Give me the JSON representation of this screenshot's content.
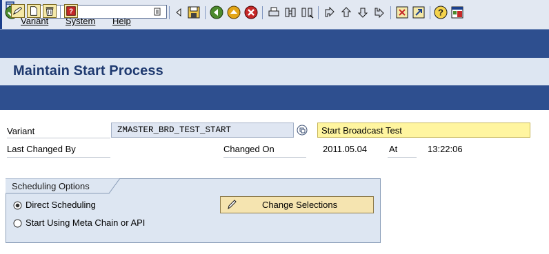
{
  "menu": {
    "items": [
      "Variant",
      "System",
      "Help"
    ]
  },
  "toolbar": {
    "command_field_value": "",
    "icons": [
      "enter-icon",
      "back-arrow-icon",
      "save-icon",
      "back-icon",
      "exit-icon",
      "cancel-icon",
      "print-icon",
      "find-icon",
      "find-next-icon",
      "first-page-icon",
      "previous-page-icon",
      "next-page-icon",
      "last-page-icon",
      "create-session-icon",
      "shortcut-icon",
      "help-icon",
      "customize-layout-icon"
    ]
  },
  "title": "Maintain Start Process",
  "app_toolbar": {
    "icons": [
      "change-icon",
      "create-icon",
      "delete-icon",
      "remove-icon"
    ]
  },
  "form": {
    "variant_label": "Variant",
    "variant_value": "ZMASTER_BRD_TEST_START",
    "variant_description": "Start Broadcast Test",
    "last_changed_by_label": "Last Changed By",
    "last_changed_by_value": "",
    "changed_on_label": "Changed On",
    "changed_on_value": "2011.05.04",
    "at_label": "At",
    "at_value": "13:22:06"
  },
  "scheduling": {
    "title": "Scheduling Options",
    "options": [
      {
        "label": "Direct Scheduling",
        "selected": true
      },
      {
        "label": "Start Using Meta Chain or API",
        "selected": false
      }
    ],
    "change_button": "Change Selections"
  },
  "colors": {
    "toolbar_blue": "#2e4f8f",
    "title_text": "#1f3a70",
    "description_field": "#fff5a0",
    "panel_bg": "#dde6f2"
  }
}
